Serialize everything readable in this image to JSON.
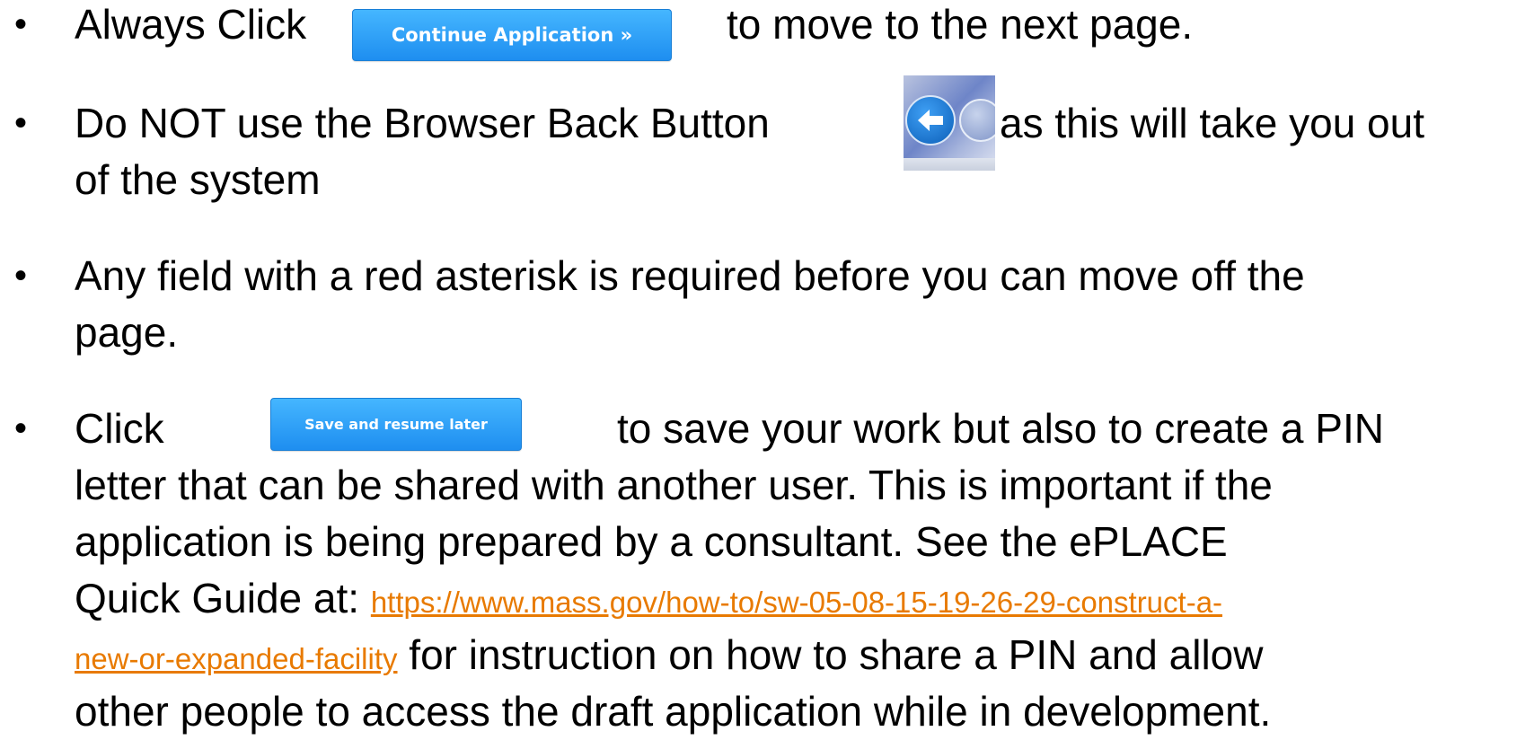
{
  "bullets": [
    {
      "before": "Always Click",
      "button": "Continue Application »",
      "after": "to move to the next page."
    },
    {
      "before": "Do NOT use the Browser Back Button",
      "after": "as this will take you out",
      "line2": "of the system"
    },
    {
      "line1": "Any field with a red asterisk is required before you can move off the",
      "line2": "page."
    },
    {
      "before": "Click",
      "button": "Save and resume later",
      "after": "to save your work but also to create a PIN",
      "line2": "letter that can be shared with another user. This is important if the",
      "line3": "application is being prepared by a consultant. See the ePLACE",
      "line4_before": "Quick Guide at: ",
      "link_part1": "https://www.mass.gov/how-to/sw-05-08-15-19-26-29-construct-a-",
      "link_part2": "new-or-expanded-facility",
      "line5_after": " for instruction on how to share a PIN and allow",
      "line6": "other people to access the draft application while in development."
    }
  ],
  "bullet_symbol": "•",
  "colors": {
    "button": "#1e8ef0",
    "link": "#e87a00"
  },
  "icons": {
    "back": "back-arrow-icon"
  }
}
